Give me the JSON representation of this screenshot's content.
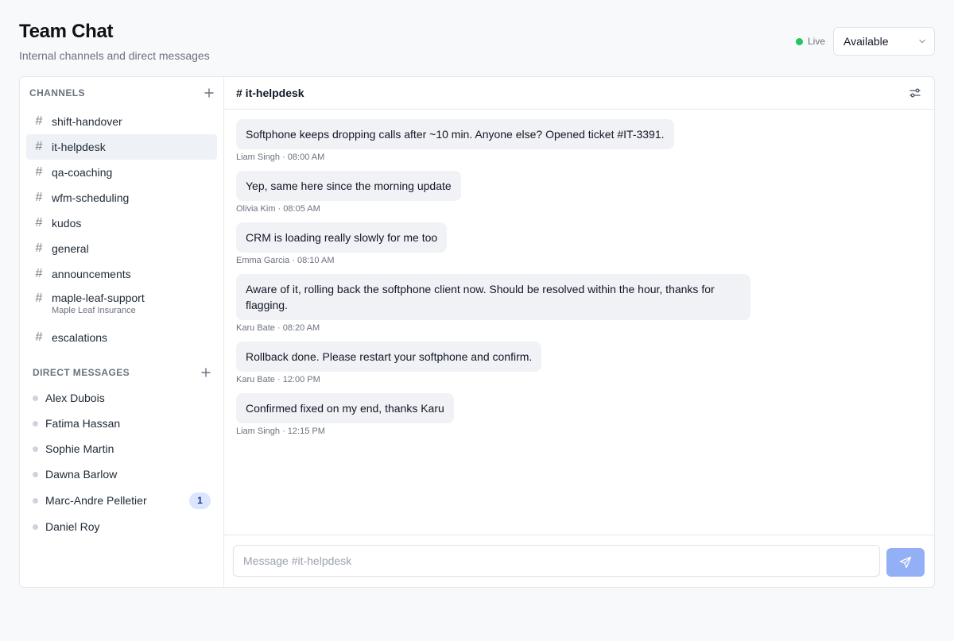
{
  "app": {
    "title": "Team Chat",
    "subtitle": "Internal channels and direct messages",
    "live_label": "Live",
    "status": "Available"
  },
  "sidebar": {
    "channels_heading": "CHANNELS",
    "dm_heading": "DIRECT MESSAGES",
    "channels": [
      {
        "name": "shift-handover"
      },
      {
        "name": "it-helpdesk",
        "active": true
      },
      {
        "name": "qa-coaching"
      },
      {
        "name": "wfm-scheduling"
      },
      {
        "name": "kudos"
      },
      {
        "name": "general"
      },
      {
        "name": "announcements"
      },
      {
        "name": "maple-leaf-support",
        "subtitle": "Maple Leaf Insurance"
      },
      {
        "name": "escalations"
      }
    ],
    "dms": [
      {
        "name": "Alex Dubois"
      },
      {
        "name": "Fatima Hassan"
      },
      {
        "name": "Sophie Martin"
      },
      {
        "name": "Dawna Barlow"
      },
      {
        "name": "Marc-Andre Pelletier",
        "unread": "1"
      },
      {
        "name": "Daniel Roy"
      }
    ]
  },
  "channel": {
    "title": "# it-helpdesk",
    "messages": [
      {
        "text": "Softphone keeps dropping calls after ~10 min. Anyone else? Opened ticket #IT-3391.",
        "meta": "Liam Singh · 08:00 AM"
      },
      {
        "text": "Yep, same here since the morning update",
        "meta": "Olivia Kim · 08:05 AM"
      },
      {
        "text": "CRM is loading really slowly for me too",
        "meta": "Emma Garcia · 08:10 AM"
      },
      {
        "text": "Aware of it, rolling back the softphone client now. Should be resolved within the hour, thanks for flagging.",
        "meta": "Karu Bate · 08:20 AM"
      },
      {
        "text": "Rollback done. Please restart your softphone and confirm.",
        "meta": "Karu Bate · 12:00 PM"
      },
      {
        "text": "Confirmed fixed on my end, thanks Karu",
        "meta": "Liam Singh · 12:15 PM"
      }
    ]
  },
  "composer": {
    "placeholder": "Message #it-helpdesk"
  },
  "colors": {
    "accent": "#93b0f7",
    "live": "#22c55e",
    "active_row": "#eef1f5"
  }
}
